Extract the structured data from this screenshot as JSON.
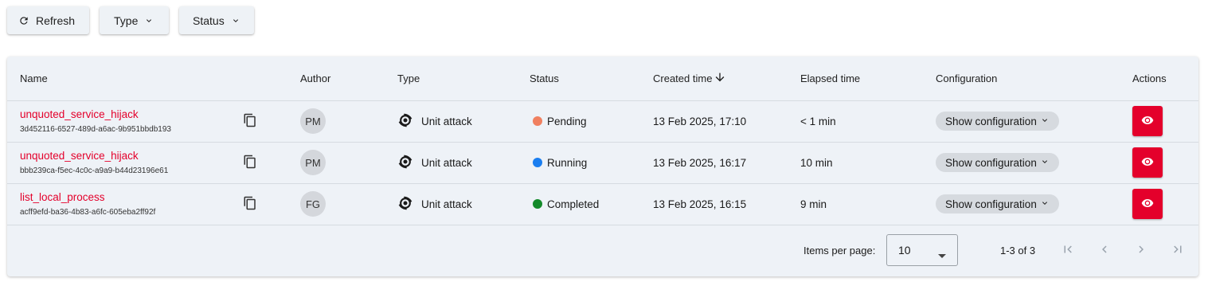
{
  "toolbar": {
    "refresh_label": "Refresh",
    "type_label": "Type",
    "status_label": "Status"
  },
  "table": {
    "columns": {
      "name": "Name",
      "author": "Author",
      "type": "Type",
      "status": "Status",
      "created": "Created time",
      "elapsed": "Elapsed time",
      "configuration": "Configuration",
      "actions": "Actions"
    },
    "rows": [
      {
        "name": "unquoted_service_hijack",
        "id": "3d452116-6527-489d-a6ac-9b951bbdb193",
        "author": "PM",
        "type": "Unit attack",
        "status": "Pending",
        "status_color": "#f08060",
        "created": "13 Feb 2025, 17:10",
        "elapsed": "< 1 min",
        "config_label": "Show configuration"
      },
      {
        "name": "unquoted_service_hijack",
        "id": "bbb239ca-f5ec-4c0c-a9a9-b44d23196e61",
        "author": "PM",
        "type": "Unit attack",
        "status": "Running",
        "status_color": "#1a7ef0",
        "created": "13 Feb 2025, 16:17",
        "elapsed": "10 min",
        "config_label": "Show configuration"
      },
      {
        "name": "list_local_process",
        "id": "acff9efd-ba36-4b83-a6fc-605eba2ff92f",
        "author": "FG",
        "type": "Unit attack",
        "status": "Completed",
        "status_color": "#138a2a",
        "created": "13 Feb 2025, 16:15",
        "elapsed": "9 min",
        "config_label": "Show configuration"
      }
    ]
  },
  "pagination": {
    "items_per_page_label": "Items per page:",
    "items_per_page_value": "10",
    "range": "1-3 of 3"
  },
  "colors": {
    "accent": "#e4002b",
    "card_bg": "#eef2f7"
  }
}
